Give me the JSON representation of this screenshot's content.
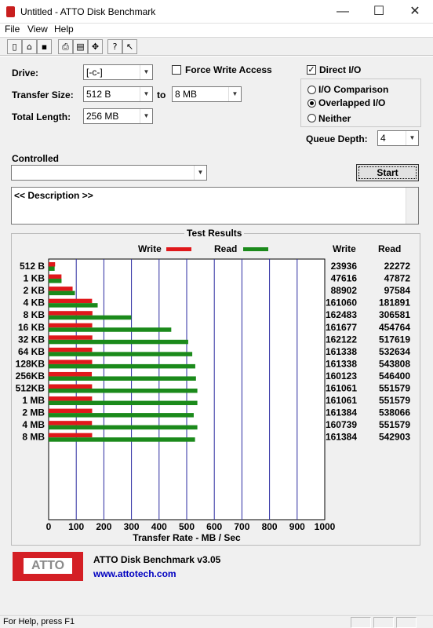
{
  "window": {
    "title": "Untitled - ATTO Disk Benchmark",
    "minimize": "—",
    "maximize": "☐",
    "close": "✕"
  },
  "menu": {
    "file": "File",
    "view": "View",
    "help": "Help"
  },
  "toolbar": {
    "icons": [
      "new-icon",
      "open-icon",
      "save-icon",
      "print-icon",
      "print-preview-icon",
      "move-icon",
      "help-icon",
      "context-help-icon"
    ]
  },
  "form": {
    "drive_label": "Drive:",
    "drive_value": "[-c-]",
    "force_write_label": "Force Write Access",
    "force_write_checked": false,
    "transfer_size_label": "Transfer Size:",
    "transfer_from": "512 B",
    "to_label": "to",
    "transfer_to": "8 MB",
    "total_length_label": "Total Length:",
    "total_length_value": "256 MB",
    "direct_io_label": "Direct I/O",
    "direct_io_checked": true,
    "io_comparison_label": "I/O Comparison",
    "overlapped_io_label": "Overlapped I/O",
    "neither_label": "Neither",
    "selected_mode": "Overlapped I/O",
    "queue_depth_label": "Queue Depth:",
    "queue_depth_value": "4",
    "controlled_label": "Controlled",
    "controlled_value": "",
    "start_label": "Start",
    "description": "<< Description >>"
  },
  "results": {
    "title": "Test Results",
    "write_legend": "Write",
    "read_legend": "Read",
    "write_header": "Write",
    "read_header": "Read",
    "write_color": "#e0181b",
    "read_color": "#1b8a1b"
  },
  "chart_data": {
    "type": "bar",
    "orientation": "horizontal",
    "categories": [
      "512 B",
      "1 KB",
      "2 KB",
      "4 KB",
      "8 KB",
      "16 KB",
      "32 KB",
      "64 KB",
      "128KB",
      "256KB",
      "512KB",
      "1 MB",
      "2 MB",
      "4 MB",
      "8 MB"
    ],
    "series": [
      {
        "name": "Write",
        "values": [
          23936,
          47616,
          88902,
          161060,
          162483,
          161677,
          162122,
          161338,
          161338,
          160123,
          161061,
          161061,
          161384,
          160739,
          161384
        ]
      },
      {
        "name": "Read",
        "values": [
          22272,
          47872,
          97584,
          181891,
          306581,
          454764,
          517619,
          532634,
          543808,
          546400,
          551579,
          551579,
          538066,
          551579,
          542903
        ]
      }
    ],
    "value_units": "KB/s",
    "xlabel": "Transfer Rate - MB / Sec",
    "xticks": [
      "0",
      "100",
      "200",
      "300",
      "400",
      "500",
      "600",
      "700",
      "800",
      "900",
      "1000"
    ],
    "xlim": [
      0,
      1000
    ],
    "grid": true,
    "legend": "top"
  },
  "branding": {
    "logo_text": "ATTO",
    "product": "ATTO Disk Benchmark v3.05",
    "url": "www.attotech.com"
  },
  "status": {
    "text": "For Help, press F1"
  }
}
